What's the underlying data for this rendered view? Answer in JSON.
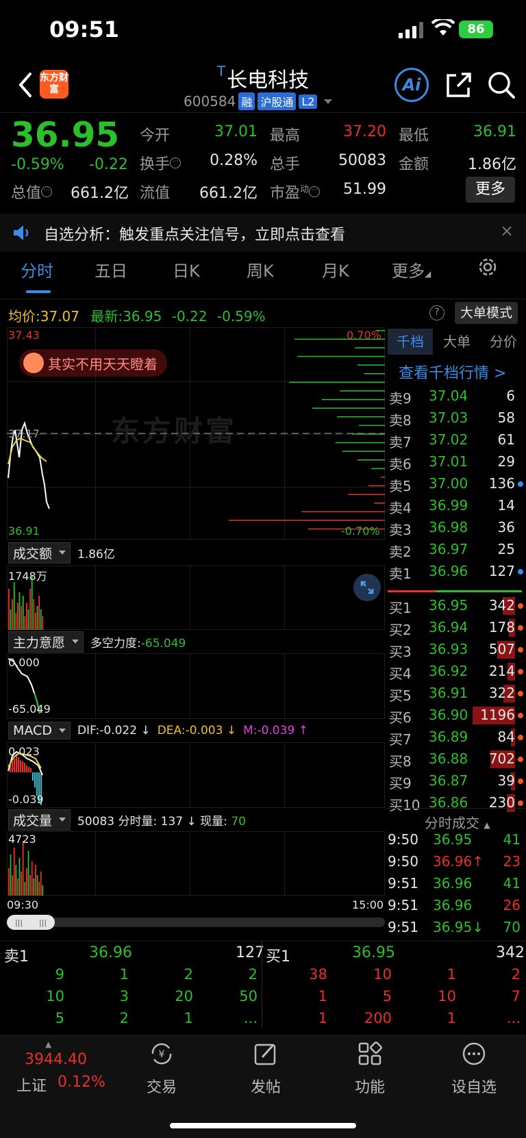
{
  "status": {
    "time": "09:51",
    "battery": "86"
  },
  "header": {
    "logo_text": "东方财富",
    "t_mark": "T",
    "name": "长电科技",
    "code": "600584",
    "tags": [
      "融",
      "沪股通",
      "L2"
    ],
    "ai_label": "Ai"
  },
  "quote": {
    "price": "36.95",
    "pct": "-0.59%",
    "change": "-0.22",
    "open_label": "今开",
    "open": "37.01",
    "high_label": "最高",
    "high": "37.20",
    "low_label": "最低",
    "low": "36.91",
    "turnover_label": "换手",
    "turnover": "0.28%",
    "volume_label": "总手",
    "volume": "50083",
    "amount_label": "金额",
    "amount": "1.86亿",
    "mktcap_label": "总值",
    "mktcap": "661.2亿",
    "float_label": "流值",
    "float": "661.2亿",
    "pe_label": "市盈",
    "pe_sup": "动",
    "pe": "51.99",
    "more": "更多"
  },
  "notice": {
    "text": "自选分析：触发重点关注信号，立即点击查看",
    "close": "×"
  },
  "tabs": [
    "分时",
    "五日",
    "日K",
    "周K",
    "月K",
    "更多"
  ],
  "chart_header": {
    "avg_label": "均价:",
    "avg": "37.07",
    "latest_label": "最新:",
    "latest": "36.95",
    "latest_chg": "-0.22",
    "latest_pct": "-0.59%",
    "bigorder": "大单模式",
    "help": "?"
  },
  "price_chart": {
    "y_top": "37.43",
    "y_mid": "37.17",
    "y_bottom": "36.91",
    "pct_top": "0.70%",
    "pct_bottom": "-0.70%",
    "bubble": "其实不用天天瞪着",
    "watermark": "东方财富"
  },
  "amount_panel": {
    "selector": "成交额",
    "value": "1.86亿",
    "y_top": "1748万"
  },
  "intent_panel": {
    "selector": "主力意愿",
    "label": "多空力度:",
    "value": "-65.049",
    "y_top": "0.000",
    "y_bottom": "-65.049"
  },
  "macd_panel": {
    "selector": "MACD",
    "dif": "DIF:-0.022 ↓",
    "dea": "DEA:-0.003 ↓",
    "m": "M:-0.039 ↑",
    "y_top": "0.023",
    "y_bottom": "-0.039"
  },
  "volume_panel": {
    "selector": "成交量",
    "total": "50083",
    "min_label": "分时量:",
    "min_vol": "137 ↓",
    "cur_label": "现量:",
    "cur_vol": "70",
    "y_top": "4723",
    "time_start": "09:30",
    "time_end": "15:00"
  },
  "order_book": {
    "tabs": [
      "千档",
      "大单",
      "分价"
    ],
    "link": "查看千档行情 >",
    "asks": [
      {
        "side": "卖9",
        "price": "37.04",
        "vol": "6"
      },
      {
        "side": "卖8",
        "price": "37.03",
        "vol": "58"
      },
      {
        "side": "卖7",
        "price": "37.02",
        "vol": "61"
      },
      {
        "side": "卖6",
        "price": "37.01",
        "vol": "29"
      },
      {
        "side": "卖5",
        "price": "37.00",
        "vol": "136"
      },
      {
        "side": "卖4",
        "price": "36.99",
        "vol": "14"
      },
      {
        "side": "卖3",
        "price": "36.98",
        "vol": "36"
      },
      {
        "side": "卖2",
        "price": "36.97",
        "vol": "25"
      },
      {
        "side": "卖1",
        "price": "36.96",
        "vol": "127"
      }
    ],
    "bids": [
      {
        "side": "买1",
        "price": "36.95",
        "vol": "342"
      },
      {
        "side": "买2",
        "price": "36.94",
        "vol": "178"
      },
      {
        "side": "买3",
        "price": "36.93",
        "vol": "507"
      },
      {
        "side": "买4",
        "price": "36.92",
        "vol": "214"
      },
      {
        "side": "买5",
        "price": "36.91",
        "vol": "322"
      },
      {
        "side": "买6",
        "price": "36.90",
        "vol": "1196"
      },
      {
        "side": "买7",
        "price": "36.89",
        "vol": "84"
      },
      {
        "side": "买8",
        "price": "36.88",
        "vol": "702"
      },
      {
        "side": "买9",
        "price": "36.87",
        "vol": "39"
      },
      {
        "side": "买10",
        "price": "36.86",
        "vol": "230"
      }
    ]
  },
  "ticks": {
    "title": "分时成交",
    "rows": [
      {
        "time": "9:50",
        "price": "36.95",
        "vol": "41"
      },
      {
        "time": "9:50",
        "price": "36.96↑",
        "vol": "23"
      },
      {
        "time": "9:51",
        "price": "36.96",
        "vol": "41"
      },
      {
        "time": "9:51",
        "price": "36.96",
        "vol": "26"
      },
      {
        "time": "9:51",
        "price": "36.95↓",
        "vol": "70"
      }
    ]
  },
  "queue": {
    "ask_label": "卖1",
    "ask_price": "36.96",
    "ask_total": "127",
    "ask_rows": [
      [
        "9",
        "1",
        "2",
        "2"
      ],
      [
        "10",
        "3",
        "20",
        "50"
      ],
      [
        "5",
        "2",
        "1",
        "..."
      ]
    ],
    "bid_label": "买1",
    "bid_price": "36.95",
    "bid_total": "342",
    "bid_rows": [
      [
        "38",
        "10",
        "1",
        "2"
      ],
      [
        "1",
        "5",
        "10",
        "7"
      ],
      [
        "1",
        "200",
        "1",
        "..."
      ]
    ]
  },
  "nav": {
    "index_value": "3944.40",
    "index_name": "上证",
    "index_pct": "0.12%",
    "items": [
      "交易",
      "发帖",
      "功能",
      "设自选"
    ]
  }
}
